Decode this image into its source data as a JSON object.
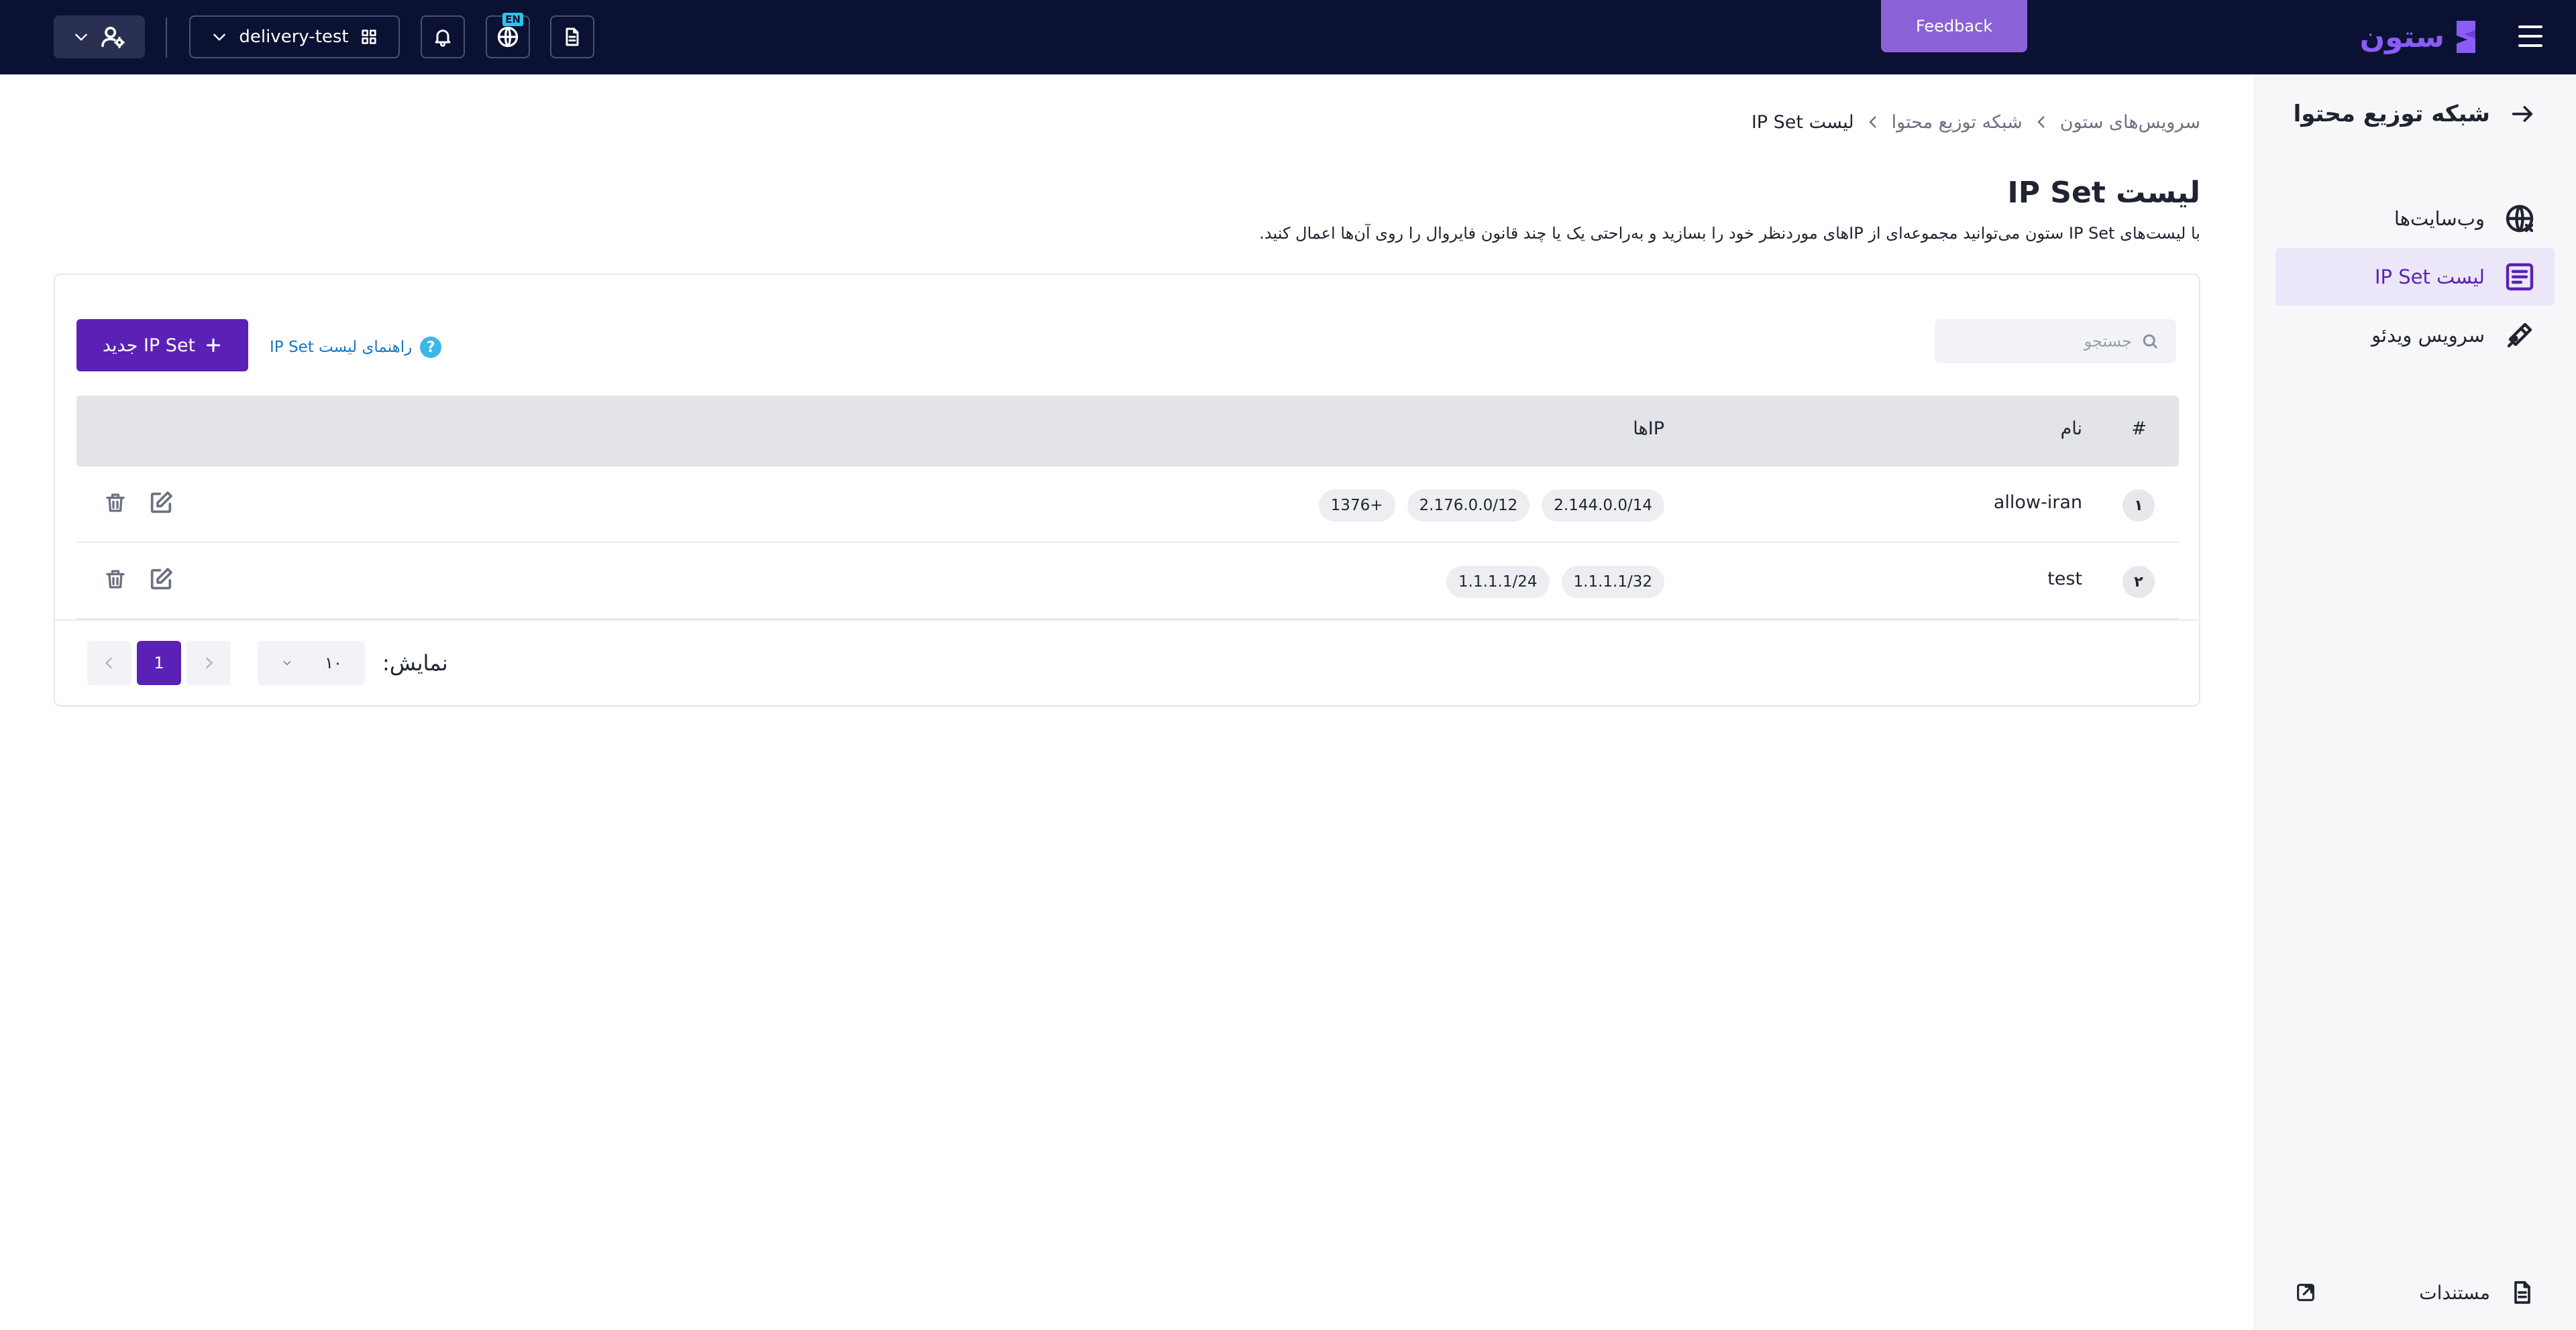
{
  "topbar": {
    "brand": "ستون",
    "feedback_label": "Feedback",
    "project_name": "delivery-test",
    "lang_badge": "EN"
  },
  "sidebar": {
    "header_title": "شبکه توزیع محتوا",
    "items": [
      {
        "label": "وب‌سایت‌ها",
        "icon": "globe-icon",
        "active": false
      },
      {
        "label": "لیست IP Set",
        "icon": "list-icon",
        "active": true
      },
      {
        "label": "سرویس ویدئو",
        "icon": "video-icon",
        "active": false
      }
    ],
    "footer_label": "مستندات"
  },
  "breadcrumb": [
    "سرویس‌های ستون",
    "شبکه توزیع محتوا",
    "لیست IP Set"
  ],
  "page": {
    "title": "لیست IP Set",
    "description": "با لیست‌های IP Set ستون می‌توانید مجموعه‌ای از IPهای موردنظر خود را بسازید و به‌راحتی یک یا چند قانون فایروال را روی آن‌ها اعمال کنید."
  },
  "toolbar": {
    "search_placeholder": "جستجو",
    "new_button_label": "IP Set جدید",
    "guide_link_label": "راهنمای لیست IP Set",
    "help_symbol": "?"
  },
  "table": {
    "columns": {
      "index": "#",
      "name": "نام",
      "ips": "IPها"
    },
    "rows": [
      {
        "index": "۱",
        "name": "allow-iran",
        "ips": [
          "2.144.0.0/14",
          "2.176.0.0/12",
          "+1376"
        ]
      },
      {
        "index": "۲",
        "name": "test",
        "ips": [
          "1.1.1.1/32",
          "1.1.1.1/24"
        ]
      }
    ]
  },
  "pagination": {
    "per_page_label": "نمایش:",
    "per_page_value": "۱۰",
    "current_page": "1"
  },
  "colors": {
    "topbar": "#0b1133",
    "accent": "#5b21b6",
    "feedback": "#8a62d6"
  }
}
